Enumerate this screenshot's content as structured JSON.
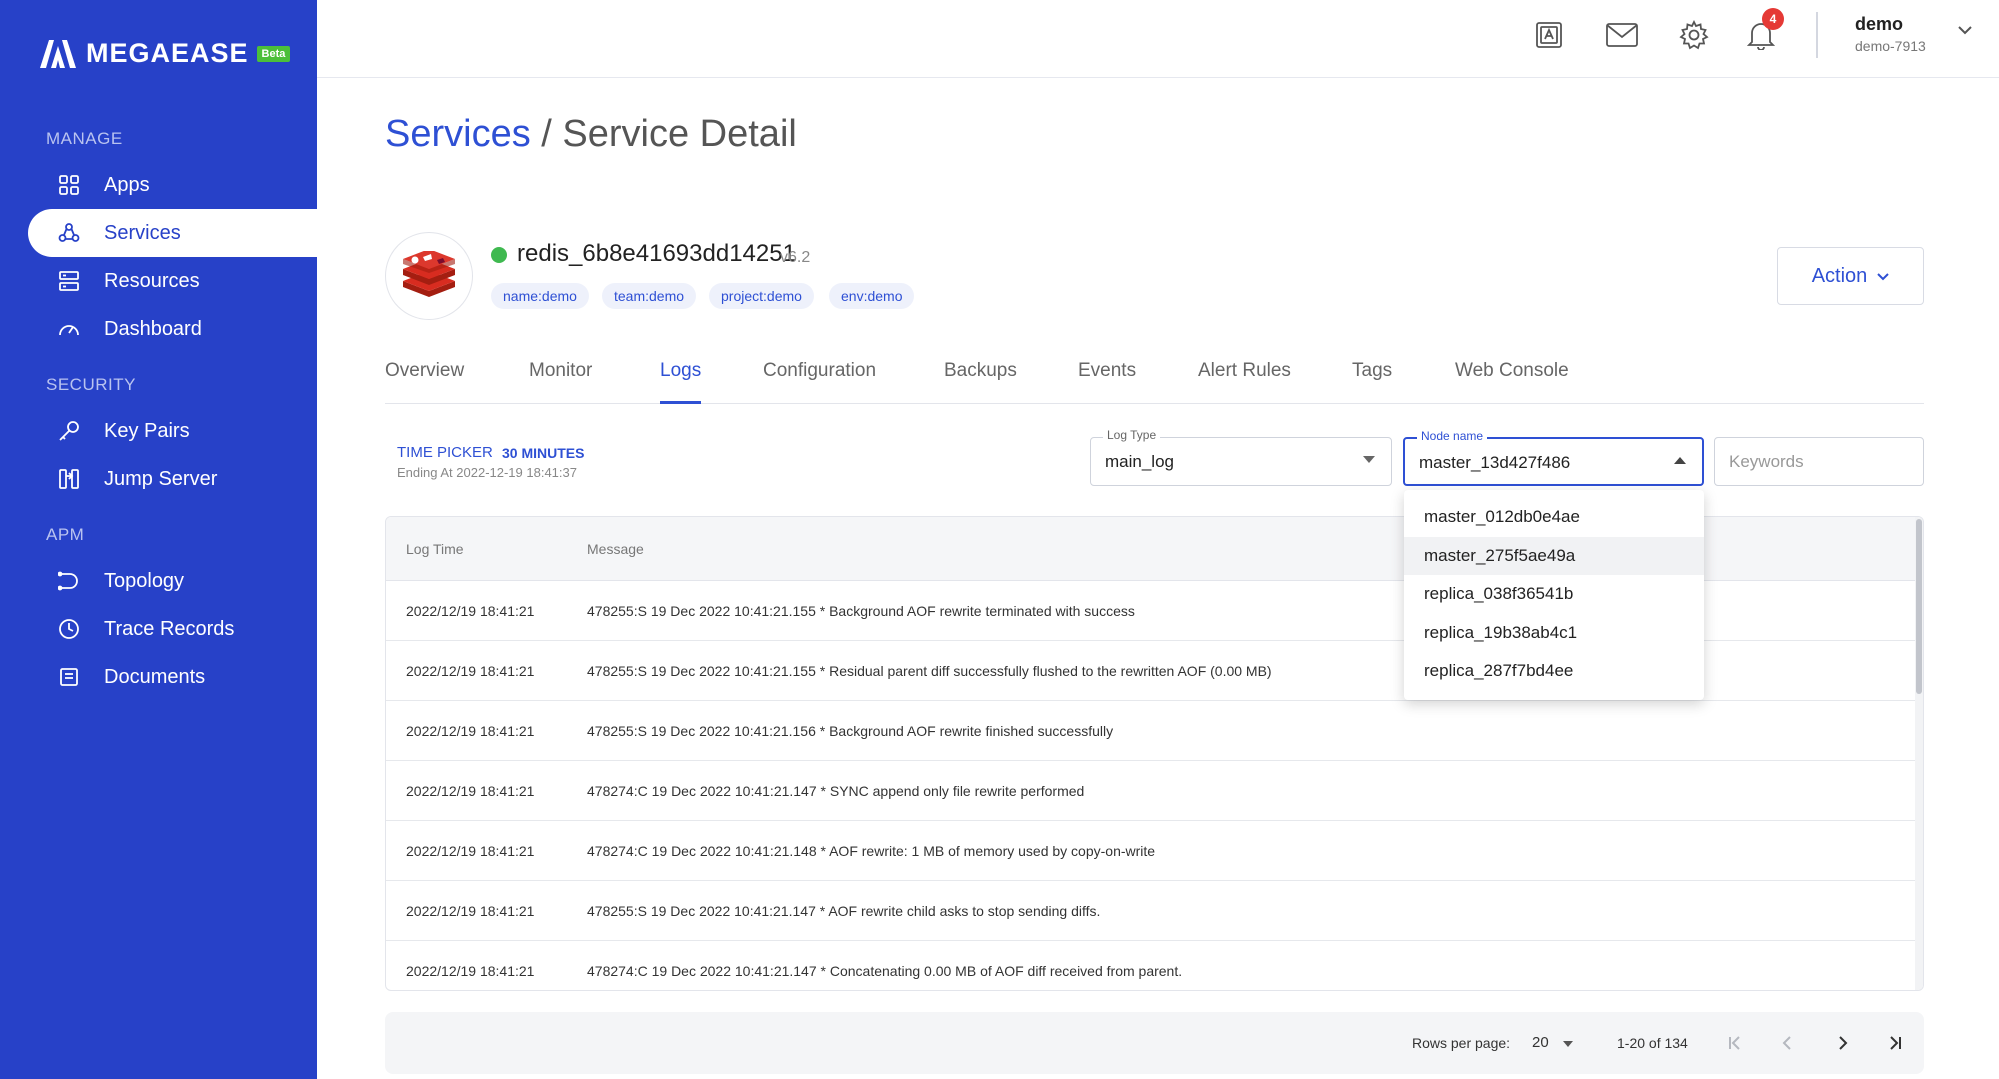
{
  "brand": {
    "name": "MEGAEASE",
    "badge": "Beta"
  },
  "sidebar": {
    "sections": [
      {
        "title": "MANAGE"
      },
      {
        "title": "SECURITY"
      },
      {
        "title": "APM"
      }
    ],
    "items": [
      {
        "label": "Apps",
        "icon": "grid-icon"
      },
      {
        "label": "Services",
        "icon": "services-icon",
        "active": true
      },
      {
        "label": "Resources",
        "icon": "server-icon"
      },
      {
        "label": "Dashboard",
        "icon": "gauge-icon"
      },
      {
        "label": "Key Pairs",
        "icon": "key-icon"
      },
      {
        "label": "Jump Server",
        "icon": "jump-server-icon"
      },
      {
        "label": "Topology",
        "icon": "topology-icon"
      },
      {
        "label": "Trace Records",
        "icon": "clock-icon"
      },
      {
        "label": "Documents",
        "icon": "document-icon"
      }
    ]
  },
  "topbar": {
    "icons": [
      "translate-icon",
      "mail-icon",
      "gear-icon",
      "bell-icon"
    ],
    "notification_count": "4",
    "user": {
      "name": "demo",
      "id": "demo-7913"
    }
  },
  "page": {
    "breadcrumb_root": "Services",
    "separator": " / ",
    "title": "Service Detail"
  },
  "service": {
    "name": "redis_6b8e41693dd14251",
    "version": "v6.2",
    "status_color": "#3fb950",
    "tags": [
      "name:demo",
      "team:demo",
      "project:demo",
      "env:demo"
    ]
  },
  "action_button": "Action",
  "tabs": [
    "Overview",
    "Monitor",
    "Logs",
    "Configuration",
    "Backups",
    "Events",
    "Alert Rules",
    "Tags",
    "Web Console"
  ],
  "active_tab": "Logs",
  "time_picker": {
    "label": "TIME PICKER",
    "value": "30 MINUTES",
    "ending": "Ending At 2022-12-19 18:41:37"
  },
  "filters": {
    "log_type": {
      "label": "Log Type",
      "value": "main_log"
    },
    "node_name": {
      "label": "Node name",
      "value": "master_13d427f486"
    },
    "keywords": {
      "placeholder": "Keywords"
    }
  },
  "node_options": [
    "master_012db0e4ae",
    "master_275f5ae49a",
    "replica_038f36541b",
    "replica_19b38ab4c1",
    "replica_287f7bd4ee"
  ],
  "table": {
    "columns": [
      "Log Time",
      "Message"
    ],
    "rows": [
      {
        "time": "2022/12/19 18:41:21",
        "message": "478255:S 19 Dec 2022 10:41:21.155 * Background AOF rewrite terminated with success"
      },
      {
        "time": "2022/12/19 18:41:21",
        "message": "478255:S 19 Dec 2022 10:41:21.155 * Residual parent diff successfully flushed to the rewritten AOF (0.00 MB)"
      },
      {
        "time": "2022/12/19 18:41:21",
        "message": "478255:S 19 Dec 2022 10:41:21.156 * Background AOF rewrite finished successfully"
      },
      {
        "time": "2022/12/19 18:41:21",
        "message": "478274:C 19 Dec 2022 10:41:21.147 * SYNC append only file rewrite performed"
      },
      {
        "time": "2022/12/19 18:41:21",
        "message": "478274:C 19 Dec 2022 10:41:21.148 * AOF rewrite: 1 MB of memory used by copy-on-write"
      },
      {
        "time": "2022/12/19 18:41:21",
        "message": "478255:S 19 Dec 2022 10:41:21.147 * AOF rewrite child asks to stop sending diffs."
      },
      {
        "time": "2022/12/19 18:41:21",
        "message": "478274:C 19 Dec 2022 10:41:21.147 * Concatenating 0.00 MB of AOF diff received from parent."
      }
    ]
  },
  "pagination": {
    "rows_per_page_label": "Rows per page:",
    "rows_per_page": "20",
    "range": "1-20 of 134"
  },
  "colors": {
    "sidebar": "#2741c8",
    "accent": "#2e50d4",
    "badge": "#4bbf3a",
    "notification": "#e53935"
  }
}
